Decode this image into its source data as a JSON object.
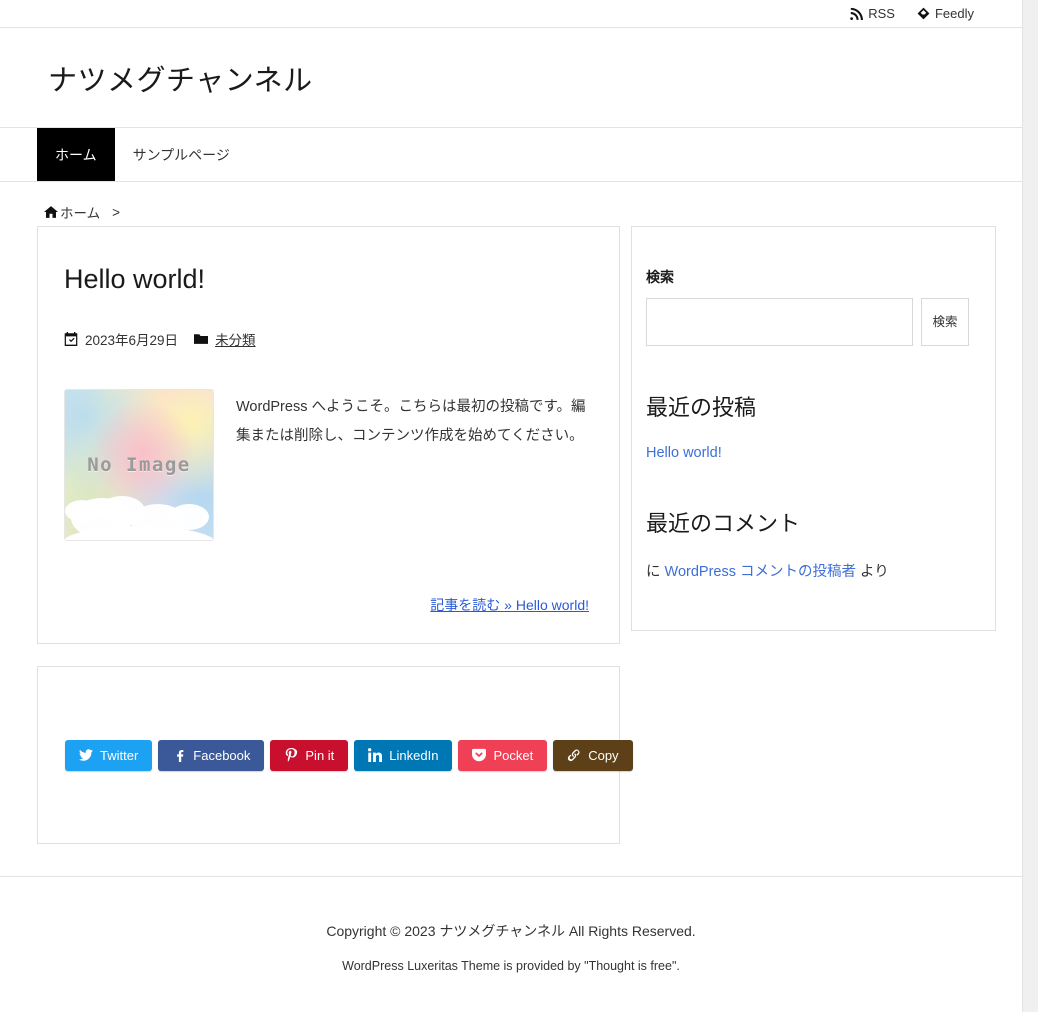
{
  "topbar": {
    "rss_label": "RSS",
    "feedly_label": "Feedly"
  },
  "header": {
    "site_title": "ナツメグチャンネル"
  },
  "nav": {
    "items": [
      {
        "label": "ホーム",
        "active": true
      },
      {
        "label": "サンプルページ",
        "active": false
      }
    ]
  },
  "breadcrumb": {
    "home_label": "ホーム",
    "separator": ">"
  },
  "post": {
    "title": "Hello world!",
    "date": "2023年6月29日",
    "category": "未分類",
    "thumb_label": "No Image",
    "excerpt": "WordPress へようこそ。こちらは最初の投稿です。編集または削除し、コンテンツ作成を始めてください。",
    "read_more": "記事を読む » Hello world!"
  },
  "sidebar": {
    "search": {
      "title": "検索",
      "value": "",
      "placeholder": "",
      "button_label": "検索"
    },
    "recent_posts": {
      "title": "最近の投稿",
      "items": [
        {
          "label": "Hello world!"
        }
      ]
    },
    "recent_comments": {
      "title": "最近のコメント",
      "prefix": "に ",
      "author": "WordPress コメントの投稿者",
      "suffix": " より"
    }
  },
  "share": {
    "buttons": [
      {
        "label": "Twitter",
        "color": "#1da1f2",
        "icon": "twitter-icon"
      },
      {
        "label": "Facebook",
        "color": "#3b5998",
        "icon": "facebook-icon"
      },
      {
        "label": "Pin it",
        "color": "#c8102e",
        "icon": "pinterest-icon"
      },
      {
        "label": "LinkedIn",
        "color": "#0077b5",
        "icon": "linkedin-icon"
      },
      {
        "label": "Pocket",
        "color": "#ef4056",
        "icon": "pocket-icon"
      },
      {
        "label": "Copy",
        "color": "#5d4017",
        "icon": "link-icon"
      }
    ]
  },
  "footer": {
    "copyright": "Copyright © 2023 ナツメグチャンネル All Rights Reserved.",
    "credit": "WordPress Luxeritas Theme is provided by \"Thought is free\"."
  }
}
